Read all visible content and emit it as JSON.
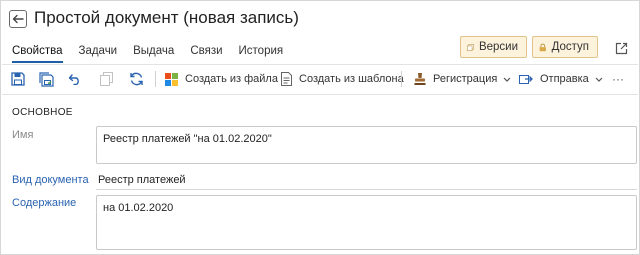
{
  "header": {
    "title": "Простой документ (новая запись)"
  },
  "tabs": [
    {
      "label": "Свойства",
      "active": true
    },
    {
      "label": "Задачи",
      "active": false
    },
    {
      "label": "Выдача",
      "active": false
    },
    {
      "label": "Связи",
      "active": false
    },
    {
      "label": "История",
      "active": false
    }
  ],
  "header_buttons": {
    "versions_label": "Версии",
    "access_label": "Доступ"
  },
  "toolbar": {
    "create_from_file": "Создать из файла",
    "create_from_template": "Создать из шаблона",
    "registration": "Регистрация",
    "sending": "Отправка",
    "more": "···"
  },
  "form": {
    "section_title": "ОСНОВНОЕ",
    "name_label": "Имя",
    "name_value": "Реестр платежей \"на 01.02.2020\"",
    "doc_kind_label": "Вид документа",
    "doc_kind_value": "Реестр платежей",
    "content_label": "Содержание",
    "content_value": "на 01.02.2020"
  },
  "colors": {
    "accent": "#1f5fa8",
    "link": "#2a63b0",
    "button_bg": "#fdf3dd",
    "button_border": "#e0c48a"
  }
}
